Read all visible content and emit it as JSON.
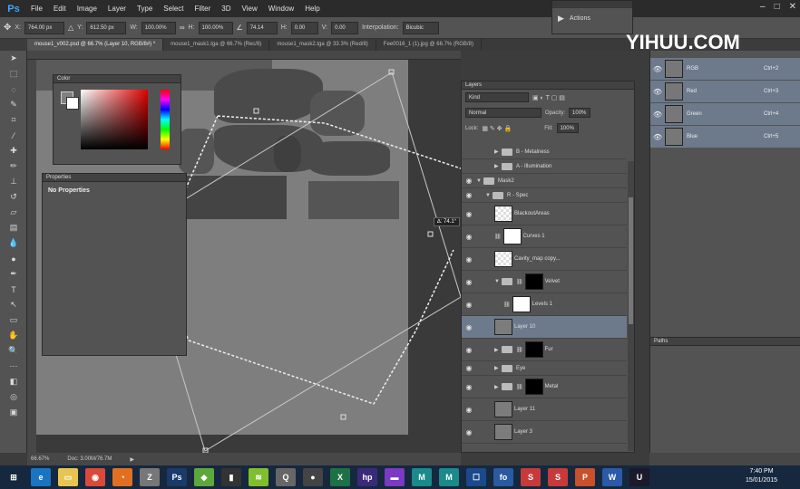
{
  "app": {
    "logo": "Ps",
    "menu": [
      "File",
      "Edit",
      "Image",
      "Layer",
      "Type",
      "Select",
      "Filter",
      "3D",
      "View",
      "Window",
      "Help"
    ]
  },
  "options_bar": {
    "x_label": "X:",
    "x_value": "764.00 px",
    "y_label": "Y:",
    "y_value": "612.50 px",
    "w_label": "W:",
    "w_value": "100.00%",
    "h_label": "H:",
    "h_value": "100.00%",
    "angle_value": "74.14",
    "hskew_label": "H:",
    "hskew_value": "0.00",
    "vskew_label": "V:",
    "vskew_value": "0.00",
    "interp_label": "Interpolation:",
    "interp_value": "Bicubic"
  },
  "actions_panel": {
    "label": "Actions"
  },
  "document_tabs": [
    {
      "label": "mouse1_v002.psd @ 66.7% (Layer 10, RGB/8#) *",
      "active": true
    },
    {
      "label": "mouse1_mask1.tga @ 66.7% (Rec/8)",
      "active": false
    },
    {
      "label": "mouse1_mask2.tga @ 33.3% (Red/8)",
      "active": false
    },
    {
      "label": "Fee0016_1 (1).jpg @ 66.7% (RGB/8)",
      "active": false
    }
  ],
  "status": {
    "zoom": "66.67%",
    "doc": "Doc: 3.00M/76.7M"
  },
  "transform_tooltip": "∆: 74.1°",
  "color_panel": {
    "title": "Color"
  },
  "properties_panel": {
    "title": "Properties",
    "message": "No Properties"
  },
  "layers_panel": {
    "title": "Layers",
    "kind_label": "Kind",
    "blend_mode": "Normal",
    "opacity_label": "Opacity:",
    "opacity_value": "100%",
    "lock_label": "Lock:",
    "fill_label": "Fill:",
    "fill_value": "100%",
    "layers": [
      {
        "name": "B - Metalness",
        "type": "group",
        "indent": 2,
        "expanded": false,
        "visible": false,
        "short": true
      },
      {
        "name": "A - Illumination",
        "type": "group",
        "indent": 2,
        "expanded": false,
        "visible": false,
        "short": true
      },
      {
        "name": "Mask2",
        "type": "group",
        "indent": 0,
        "expanded": true,
        "visible": true,
        "short": true
      },
      {
        "name": "R - Spec",
        "type": "group",
        "indent": 1,
        "expanded": true,
        "visible": true,
        "short": true
      },
      {
        "name": "BlackoutAreas",
        "type": "layer",
        "indent": 2,
        "thumb": "check",
        "visible": true
      },
      {
        "name": "Curves 1",
        "type": "adjustment",
        "indent": 2,
        "thumb": "white",
        "visible": true
      },
      {
        "name": "Cavity_map copy...",
        "type": "layer",
        "indent": 2,
        "thumb": "check",
        "visible": true
      },
      {
        "name": "Velvet",
        "type": "group-mask",
        "indent": 2,
        "expanded": true,
        "thumb": "mask",
        "visible": true
      },
      {
        "name": "Levels 1",
        "type": "adjustment",
        "indent": 3,
        "thumb": "white",
        "visible": true
      },
      {
        "name": "Layer 10",
        "type": "layer",
        "indent": 2,
        "thumb": "grey",
        "visible": true,
        "selected": true
      },
      {
        "name": "Fur",
        "type": "group-mask",
        "indent": 2,
        "expanded": false,
        "thumb": "mask",
        "visible": true
      },
      {
        "name": "Eye",
        "type": "group",
        "indent": 2,
        "expanded": false,
        "visible": true,
        "short": true
      },
      {
        "name": "Metal",
        "type": "group-mask",
        "indent": 2,
        "expanded": false,
        "thumb": "mask",
        "visible": true
      },
      {
        "name": "Layer 11",
        "type": "layer",
        "indent": 2,
        "thumb": "grey",
        "visible": true
      },
      {
        "name": "Layer 3",
        "type": "layer",
        "indent": 2,
        "thumb": "grey",
        "visible": true
      }
    ]
  },
  "channels_panel": {
    "channels": [
      {
        "name": "RGB",
        "shortcut": "Ctrl+2"
      },
      {
        "name": "Red",
        "shortcut": "Ctrl+3"
      },
      {
        "name": "Green",
        "shortcut": "Ctrl+4"
      },
      {
        "name": "Blue",
        "shortcut": "Ctrl+5"
      }
    ]
  },
  "paths_panel": {
    "title": "Paths"
  },
  "watermark": "YIHUU.COM",
  "taskbar": {
    "time": "7:40 PM",
    "date": "15/01/2015",
    "icons": [
      {
        "label": "start",
        "color": "#16283e",
        "glyph": "⊞"
      },
      {
        "label": "ie",
        "color": "#1a74c4",
        "glyph": "e"
      },
      {
        "label": "explorer",
        "color": "#e8c550",
        "glyph": "▭"
      },
      {
        "label": "chrome",
        "color": "#d94a3a",
        "glyph": "◉"
      },
      {
        "label": "firefox",
        "color": "#e07020",
        "glyph": "◔"
      },
      {
        "label": "zbrush",
        "color": "#777777",
        "glyph": "Z"
      },
      {
        "label": "photoshop",
        "color": "#1a3a6a",
        "glyph": "Ps"
      },
      {
        "label": "app-green",
        "color": "#5da83c",
        "glyph": "◆"
      },
      {
        "label": "app-dark",
        "color": "#333333",
        "glyph": "▮"
      },
      {
        "label": "spotify",
        "color": "#7fbf2e",
        "glyph": "≋"
      },
      {
        "label": "quicktime",
        "color": "#666666",
        "glyph": "Q"
      },
      {
        "label": "app-round",
        "color": "#444444",
        "glyph": "●"
      },
      {
        "label": "excel",
        "color": "#1e7145",
        "glyph": "X"
      },
      {
        "label": "hp",
        "color": "#3a2a7a",
        "glyph": "hp"
      },
      {
        "label": "app-purple",
        "color": "#7a3ac4",
        "glyph": "▬"
      },
      {
        "label": "maya1",
        "color": "#1a8a8a",
        "glyph": "M"
      },
      {
        "label": "maya2",
        "color": "#1a8a8a",
        "glyph": "M"
      },
      {
        "label": "app-blue",
        "color": "#1a4a8a",
        "glyph": "☐"
      },
      {
        "label": "app-blue2",
        "color": "#2a5aa0",
        "glyph": "fo"
      },
      {
        "label": "sub1",
        "color": "#c83a3a",
        "glyph": "S"
      },
      {
        "label": "sub2",
        "color": "#c83a3a",
        "glyph": "S"
      },
      {
        "label": "powerpoint",
        "color": "#c8502a",
        "glyph": "P"
      },
      {
        "label": "word",
        "color": "#2a5aa8",
        "glyph": "W"
      },
      {
        "label": "unreal",
        "color": "#1a1a2a",
        "glyph": "U"
      }
    ]
  }
}
